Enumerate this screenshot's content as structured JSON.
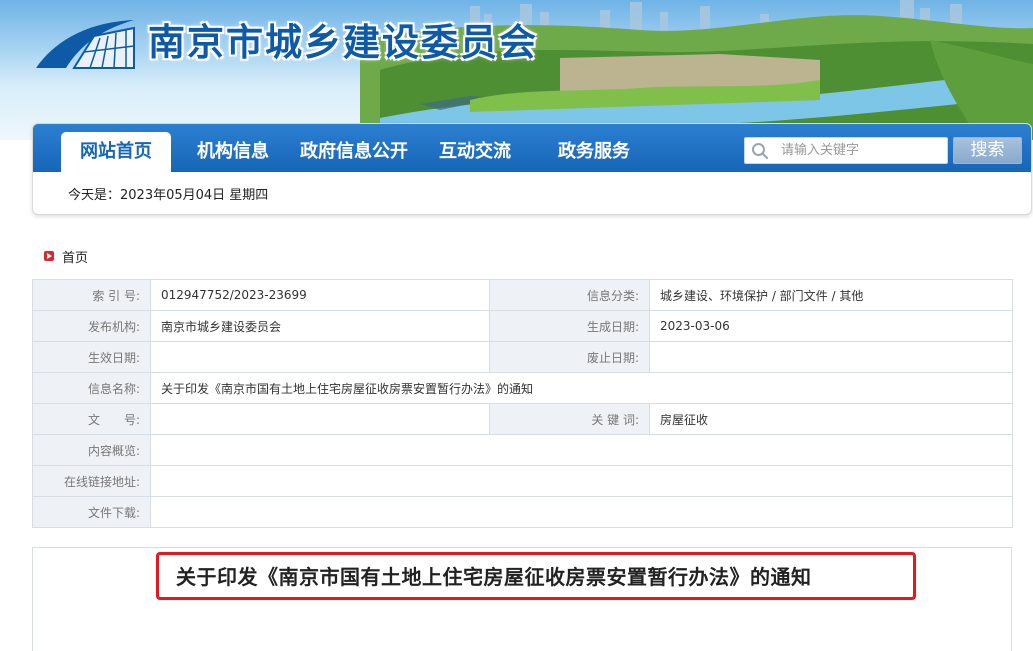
{
  "site": {
    "title": "南京市城乡建设委员会",
    "brand_color": "#1766b8",
    "title_color": "#0e5aa7"
  },
  "nav": {
    "items": [
      {
        "label": "网站首页",
        "active": true
      },
      {
        "label": "机构信息",
        "active": false
      },
      {
        "label": "政府信息公开",
        "active": false
      },
      {
        "label": "互动交流",
        "active": false
      },
      {
        "label": "政务服务",
        "active": false
      }
    ],
    "search": {
      "placeholder": "请输入关键字",
      "button_label": "搜索",
      "icon": "search-icon"
    }
  },
  "date_line": "今天是：2023年05月04日  星期四",
  "breadcrumb": {
    "icon": "arrow-right-icon",
    "home_label": "首页"
  },
  "meta": {
    "index_label": "索 引 号:",
    "index_value": "012947752/2023-23699",
    "category_label": "信息分类:",
    "category_value": "城乡建设、环境保护 / 部门文件 / 其他",
    "publisher_label": "发布机构:",
    "publisher_value": "南京市城乡建设委员会",
    "generated_label": "生成日期:",
    "generated_value": "2023-03-06",
    "effective_label": "生效日期:",
    "effective_value": "",
    "abolished_label": "废止日期:",
    "abolished_value": "",
    "name_label": "信息名称:",
    "name_value": "关于印发《南京市国有土地上住宅房屋征收房票安置暂行办法》的通知",
    "docno_label": "文　　号:",
    "docno_value": "",
    "keywords_label": "关 键 词:",
    "keywords_value": "房屋征收",
    "summary_label": "内容概览:",
    "summary_value": "",
    "link_label": "在线链接地址:",
    "link_value": "",
    "download_label": "文件下载:",
    "download_value": ""
  },
  "document": {
    "title": "关于印发《南京市国有土地上住宅房屋征收房票安置暂行办法》的通知",
    "highlight_color": "#e5171f"
  }
}
